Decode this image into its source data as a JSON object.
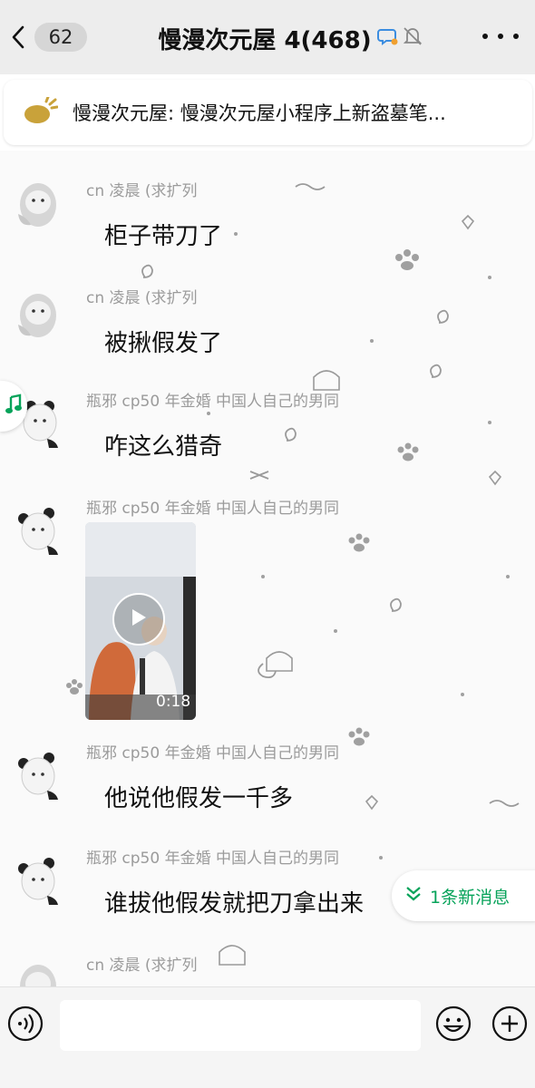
{
  "header": {
    "back_count": "62",
    "title": "慢漫次元屋 4(468)"
  },
  "notice": {
    "text": "慢漫次元屋: 慢漫次元屋小程序上新盗墓笔..."
  },
  "messages": [
    {
      "sender": "cn 凌晨 (求扩列",
      "text": "柜子带刀了"
    },
    {
      "sender": "cn 凌晨 (求扩列",
      "text": "被揪假发了"
    },
    {
      "sender": "瓶邪 cp50 年金婚 中国人自己的男同",
      "text": "咋这么猎奇"
    },
    {
      "sender": "瓶邪 cp50 年金婚 中国人自己的男同",
      "video_duration": "0:18"
    },
    {
      "sender": "瓶邪 cp50 年金婚 中国人自己的男同",
      "text": "他说他假发一千多"
    },
    {
      "sender": "瓶邪 cp50 年金婚 中国人自己的男同",
      "text": "谁拔他假发就把刀拿出来"
    },
    {
      "sender": "cn 凌晨 (求扩列",
      "text": ""
    }
  ],
  "new_message_banner": "1条新消息",
  "input": {
    "placeholder": ""
  },
  "colors": {
    "accent_green": "#07a35a",
    "header_bg": "#ededed",
    "sender_gray": "#9b9b9b"
  },
  "icons": {
    "back": "chevron-left-icon",
    "group_chat": "chat-bubble-icon",
    "mute": "bell-off-icon",
    "more": "ellipsis-icon",
    "notice": "megaphone-icon",
    "music": "music-note-icon",
    "new_messages": "double-chevron-down-icon",
    "voice": "voice-icon",
    "emoji": "emoji-icon",
    "plus": "plus-icon"
  }
}
